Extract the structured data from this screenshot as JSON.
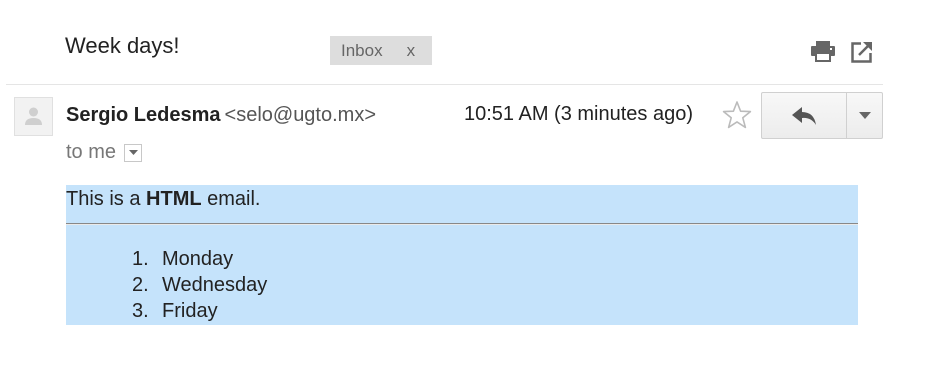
{
  "email": {
    "subject": "Week days!",
    "label": {
      "text": "Inbox",
      "remove": "x"
    },
    "sender": {
      "name": "Sergio Ledesma",
      "email": "<selo@ugto.mx>"
    },
    "timestamp": "10:51 AM (3 minutes ago)",
    "recipient": "to me",
    "body": {
      "intro_before": "This is a ",
      "intro_bold": "HTML",
      "intro_after": " email.",
      "list": [
        {
          "num": "1.",
          "text": "Monday"
        },
        {
          "num": "2.",
          "text": "Wednesday"
        },
        {
          "num": "3.",
          "text": "Friday"
        }
      ]
    }
  },
  "icons": {
    "print": "print-icon",
    "new_window": "new-window-icon",
    "star": "star-icon",
    "reply": "reply-icon",
    "more": "chevron-down-icon",
    "avatar": "person-icon"
  },
  "colors": {
    "body_highlight": "#c5e3fb",
    "label_chip": "#dddddd"
  }
}
